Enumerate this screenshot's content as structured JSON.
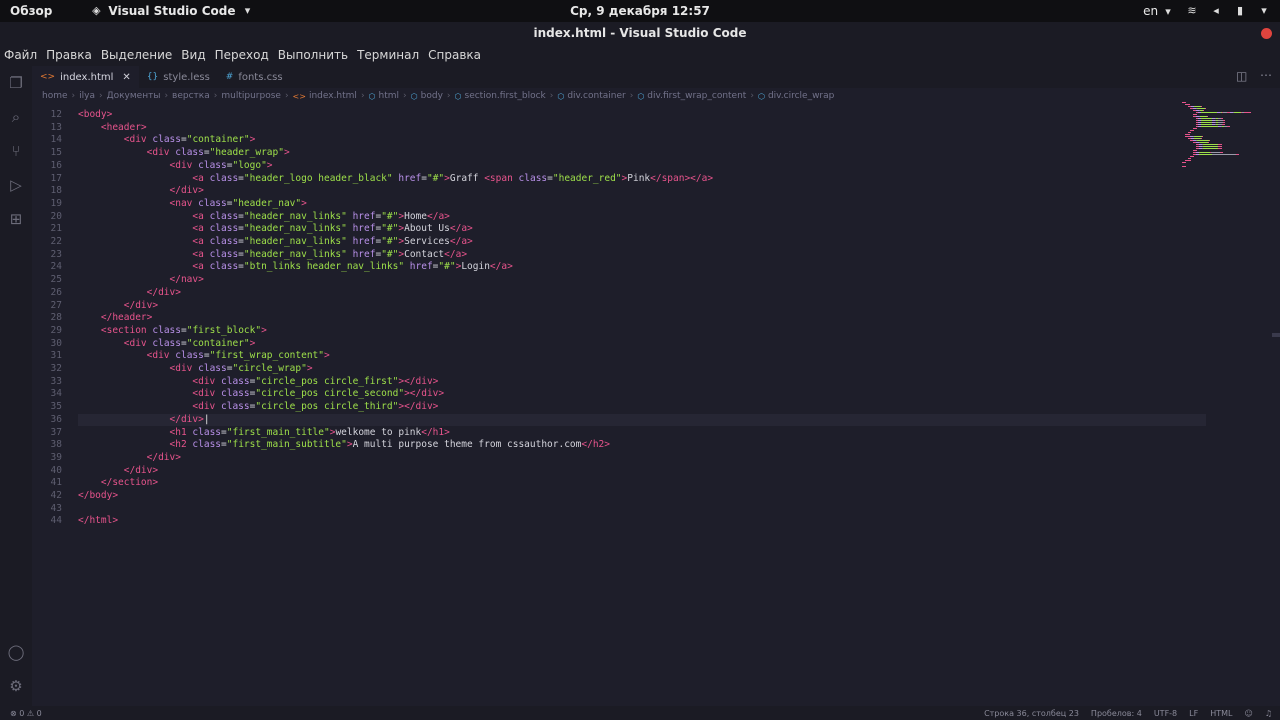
{
  "topbar": {
    "overview": "Обзор",
    "app_name": "Visual Studio Code",
    "clock": "Ср, 9 декабря  12:57",
    "lang": "en"
  },
  "window": {
    "title": "index.html - Visual Studio Code"
  },
  "menu": [
    "Файл",
    "Правка",
    "Выделение",
    "Вид",
    "Переход",
    "Выполнить",
    "Терминал",
    "Справка"
  ],
  "tabs": [
    {
      "icon": "<>",
      "label": "index.html"
    },
    {
      "icon": "{}",
      "label": "style.less"
    },
    {
      "icon": "#",
      "label": "fonts.css"
    }
  ],
  "breadcrumb": [
    "home",
    "ilya",
    "Документы",
    "верстка",
    "multipurpose",
    "index.html",
    "html",
    "body",
    "section.first_block",
    "div.container",
    "div.first_wrap_content",
    "div.circle_wrap"
  ],
  "code": [
    {
      "n": "12",
      "i": 0,
      "t": [
        [
          "tag",
          "<body>"
        ]
      ]
    },
    {
      "n": "13",
      "i": 4,
      "t": [
        [
          "tag",
          "<header>"
        ]
      ]
    },
    {
      "n": "14",
      "i": 8,
      "t": [
        [
          "tag",
          "<div "
        ],
        [
          "attr",
          "class"
        ],
        [
          "pun",
          "="
        ],
        [
          "str",
          "\"container\""
        ],
        [
          "tag",
          ">"
        ]
      ]
    },
    {
      "n": "15",
      "i": 12,
      "t": [
        [
          "tag",
          "<div "
        ],
        [
          "attr",
          "class"
        ],
        [
          "pun",
          "="
        ],
        [
          "str",
          "\"header_wrap\""
        ],
        [
          "tag",
          ">"
        ]
      ]
    },
    {
      "n": "16",
      "i": 16,
      "t": [
        [
          "tag",
          "<div "
        ],
        [
          "attr",
          "class"
        ],
        [
          "pun",
          "="
        ],
        [
          "str",
          "\"logo\""
        ],
        [
          "tag",
          ">"
        ]
      ]
    },
    {
      "n": "17",
      "i": 20,
      "t": [
        [
          "tag",
          "<a "
        ],
        [
          "attr",
          "class"
        ],
        [
          "pun",
          "="
        ],
        [
          "str",
          "\"header_logo header_black\""
        ],
        [
          "attr",
          " href"
        ],
        [
          "pun",
          "="
        ],
        [
          "str",
          "\"#\""
        ],
        [
          "tag",
          ">"
        ],
        [
          "txt",
          "Graff "
        ],
        [
          "tag",
          "<span "
        ],
        [
          "attr",
          "class"
        ],
        [
          "pun",
          "="
        ],
        [
          "str",
          "\"header_red\""
        ],
        [
          "tag",
          ">"
        ],
        [
          "txt",
          "Pink"
        ],
        [
          "tag",
          "</span></a>"
        ]
      ]
    },
    {
      "n": "18",
      "i": 16,
      "t": [
        [
          "tag",
          "</div>"
        ]
      ]
    },
    {
      "n": "19",
      "i": 16,
      "t": [
        [
          "tag",
          "<nav "
        ],
        [
          "attr",
          "class"
        ],
        [
          "pun",
          "="
        ],
        [
          "str",
          "\"header_nav\""
        ],
        [
          "tag",
          ">"
        ]
      ]
    },
    {
      "n": "20",
      "i": 20,
      "t": [
        [
          "tag",
          "<a "
        ],
        [
          "attr",
          "class"
        ],
        [
          "pun",
          "="
        ],
        [
          "str",
          "\"header_nav_links\""
        ],
        [
          "attr",
          " href"
        ],
        [
          "pun",
          "="
        ],
        [
          "str",
          "\"#\""
        ],
        [
          "tag",
          ">"
        ],
        [
          "txt",
          "Home"
        ],
        [
          "tag",
          "</a>"
        ]
      ]
    },
    {
      "n": "21",
      "i": 20,
      "t": [
        [
          "tag",
          "<a "
        ],
        [
          "attr",
          "class"
        ],
        [
          "pun",
          "="
        ],
        [
          "str",
          "\"header_nav_links\""
        ],
        [
          "attr",
          " href"
        ],
        [
          "pun",
          "="
        ],
        [
          "str",
          "\"#\""
        ],
        [
          "tag",
          ">"
        ],
        [
          "txt",
          "About Us"
        ],
        [
          "tag",
          "</a>"
        ]
      ]
    },
    {
      "n": "22",
      "i": 20,
      "t": [
        [
          "tag",
          "<a "
        ],
        [
          "attr",
          "class"
        ],
        [
          "pun",
          "="
        ],
        [
          "str",
          "\"header_nav_links\""
        ],
        [
          "attr",
          " href"
        ],
        [
          "pun",
          "="
        ],
        [
          "str",
          "\"#\""
        ],
        [
          "tag",
          ">"
        ],
        [
          "txt",
          "Services"
        ],
        [
          "tag",
          "</a>"
        ]
      ]
    },
    {
      "n": "23",
      "i": 20,
      "t": [
        [
          "tag",
          "<a "
        ],
        [
          "attr",
          "class"
        ],
        [
          "pun",
          "="
        ],
        [
          "str",
          "\"header_nav_links\""
        ],
        [
          "attr",
          " href"
        ],
        [
          "pun",
          "="
        ],
        [
          "str",
          "\"#\""
        ],
        [
          "tag",
          ">"
        ],
        [
          "txt",
          "Contact"
        ],
        [
          "tag",
          "</a>"
        ]
      ]
    },
    {
      "n": "24",
      "i": 20,
      "t": [
        [
          "tag",
          "<a "
        ],
        [
          "attr",
          "class"
        ],
        [
          "pun",
          "="
        ],
        [
          "str",
          "\"btn_links header_nav_links\""
        ],
        [
          "attr",
          " href"
        ],
        [
          "pun",
          "="
        ],
        [
          "str",
          "\"#\""
        ],
        [
          "tag",
          ">"
        ],
        [
          "txt",
          "Login"
        ],
        [
          "tag",
          "</a>"
        ]
      ]
    },
    {
      "n": "25",
      "i": 16,
      "t": [
        [
          "tag",
          "</nav>"
        ]
      ]
    },
    {
      "n": "26",
      "i": 12,
      "t": [
        [
          "tag",
          "</div>"
        ]
      ]
    },
    {
      "n": "27",
      "i": 8,
      "t": [
        [
          "tag",
          "</div>"
        ]
      ]
    },
    {
      "n": "28",
      "i": 4,
      "t": [
        [
          "tag",
          "</header>"
        ]
      ]
    },
    {
      "n": "29",
      "i": 4,
      "t": [
        [
          "tag",
          "<section "
        ],
        [
          "attr",
          "class"
        ],
        [
          "pun",
          "="
        ],
        [
          "str",
          "\"first_block\""
        ],
        [
          "tag",
          ">"
        ]
      ]
    },
    {
      "n": "30",
      "i": 8,
      "t": [
        [
          "tag",
          "<div "
        ],
        [
          "attr",
          "class"
        ],
        [
          "pun",
          "="
        ],
        [
          "str",
          "\"container\""
        ],
        [
          "tag",
          ">"
        ]
      ]
    },
    {
      "n": "31",
      "i": 12,
      "t": [
        [
          "tag",
          "<div "
        ],
        [
          "attr",
          "class"
        ],
        [
          "pun",
          "="
        ],
        [
          "str",
          "\"first_wrap_content\""
        ],
        [
          "tag",
          ">"
        ]
      ]
    },
    {
      "n": "32",
      "i": 16,
      "t": [
        [
          "tag",
          "<div "
        ],
        [
          "attr",
          "class"
        ],
        [
          "pun",
          "="
        ],
        [
          "str",
          "\"circle_wrap\""
        ],
        [
          "tag",
          ">"
        ]
      ]
    },
    {
      "n": "33",
      "i": 20,
      "t": [
        [
          "tag",
          "<div "
        ],
        [
          "attr",
          "class"
        ],
        [
          "pun",
          "="
        ],
        [
          "str",
          "\"circle_pos circle_first\""
        ],
        [
          "tag",
          "></div>"
        ]
      ]
    },
    {
      "n": "34",
      "i": 20,
      "t": [
        [
          "tag",
          "<div "
        ],
        [
          "attr",
          "class"
        ],
        [
          "pun",
          "="
        ],
        [
          "str",
          "\"circle_pos circle_second\""
        ],
        [
          "tag",
          "></div>"
        ]
      ]
    },
    {
      "n": "35",
      "i": 20,
      "t": [
        [
          "tag",
          "<div "
        ],
        [
          "attr",
          "class"
        ],
        [
          "pun",
          "="
        ],
        [
          "str",
          "\"circle_pos circle_third\""
        ],
        [
          "tag",
          "></div>"
        ]
      ]
    },
    {
      "n": "36",
      "i": 16,
      "t": [
        [
          "tag",
          "</div>"
        ]
      ],
      "current": true
    },
    {
      "n": "37",
      "i": 16,
      "t": [
        [
          "tag",
          "<h1 "
        ],
        [
          "attr",
          "class"
        ],
        [
          "pun",
          "="
        ],
        [
          "str",
          "\"first_main_title\""
        ],
        [
          "tag",
          ">"
        ],
        [
          "txt",
          "welkome to pink"
        ],
        [
          "tag",
          "</h1>"
        ]
      ]
    },
    {
      "n": "38",
      "i": 16,
      "t": [
        [
          "tag",
          "<h2 "
        ],
        [
          "attr",
          "class"
        ],
        [
          "pun",
          "="
        ],
        [
          "str",
          "\"first_main_subtitle\""
        ],
        [
          "tag",
          ">"
        ],
        [
          "txt",
          "A multi purpose theme from cssauthor.com"
        ],
        [
          "tag",
          "</h2>"
        ]
      ]
    },
    {
      "n": "39",
      "i": 12,
      "t": [
        [
          "tag",
          "</div>"
        ]
      ]
    },
    {
      "n": "40",
      "i": 8,
      "t": [
        [
          "tag",
          "</div>"
        ]
      ]
    },
    {
      "n": "41",
      "i": 4,
      "t": [
        [
          "tag",
          "</section>"
        ]
      ]
    },
    {
      "n": "42",
      "i": 0,
      "t": [
        [
          "tag",
          "</body>"
        ]
      ]
    },
    {
      "n": "43",
      "i": 0,
      "t": []
    },
    {
      "n": "44",
      "i": 0,
      "t": [
        [
          "tag",
          "</html>"
        ]
      ]
    }
  ],
  "status": {
    "problems": "⊗ 0 ⚠ 0",
    "cursor": "Строка 36, столбец 23",
    "indent": "Пробелов: 4",
    "encoding": "UTF-8",
    "eol": "LF",
    "language": "HTML"
  },
  "colors": {
    "tag": "#e7548c",
    "attr": "#b890e8",
    "string": "#9ee04a",
    "background": "#1e1e2a"
  }
}
